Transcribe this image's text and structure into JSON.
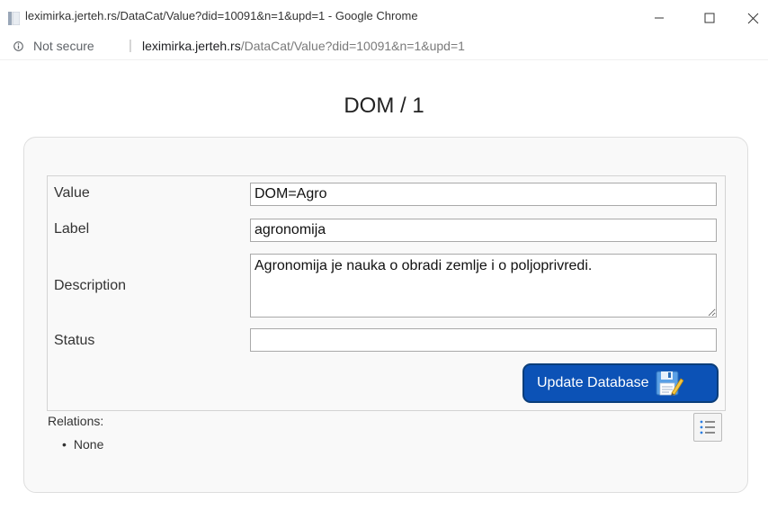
{
  "window": {
    "title": "leximirka.jerteh.rs/DataCat/Value?did=10091&n=1&upd=1 - Google Chrome",
    "minimize_icon": "minimize-icon",
    "maximize_icon": "maximize-icon",
    "close_icon": "close-icon"
  },
  "address_bar": {
    "security_label": "Not secure",
    "separator": "|",
    "host": "leximirka.jerteh.rs",
    "path": "/DataCat/Value?did=10091&n=1&upd=1"
  },
  "page": {
    "title": "DOM / 1"
  },
  "form": {
    "value_label": "Value",
    "value": "DOM=Agro",
    "label_label": "Label",
    "label_value": "agronomija",
    "description_label": "Description",
    "description_value": "Agronomija je nauka o obradi zemlje i o poljoprivredi.",
    "status_label": "Status",
    "status_value": "",
    "update_button_label": "Update Database"
  },
  "relations": {
    "heading": "Relations:",
    "items": [
      "None"
    ]
  },
  "colors": {
    "button_bg": "#0c52b6",
    "button_border": "#0b3e7a",
    "panel_bg": "#f9f9f9"
  }
}
